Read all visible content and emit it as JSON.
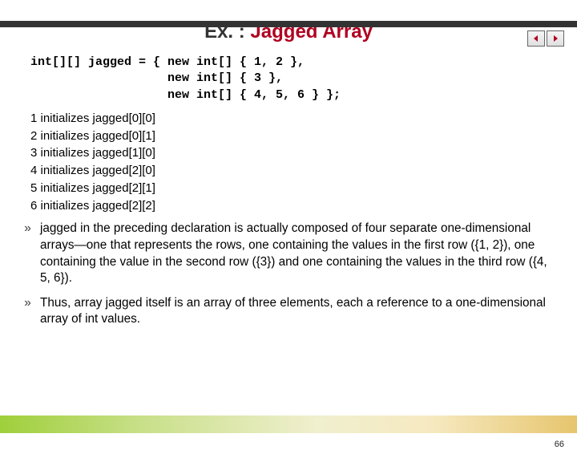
{
  "title": {
    "pre": "Ex. : ",
    "hl": "Jagged Array"
  },
  "code": {
    "l1": "int[][] jagged = { new int[] { 1, 2 },",
    "l2": "                   new int[] { 3 },",
    "l3": "                   new int[] { 4, 5, 6 } };"
  },
  "inits": [
    "1 initializes jagged[0][0]",
    "2 initializes jagged[0][1]",
    "3 initializes jagged[1][0]",
    "4 initializes jagged[2][0]",
    "5 initializes jagged[2][1]",
    "6 initializes jagged[2][2]"
  ],
  "bullet": "»",
  "para1": "jagged in the preceding declaration is actually composed of four separate one-dimensional arrays—one that represents the rows, one containing the values in the first row ({1, 2}), one containing the value in the second row ({3}) and one containing the values in the third row ({4, 5, 6}).",
  "para2": "Thus, array jagged itself is an array of three elements, each a reference to a one-dimensional array of int values.",
  "pageNumber": "66"
}
